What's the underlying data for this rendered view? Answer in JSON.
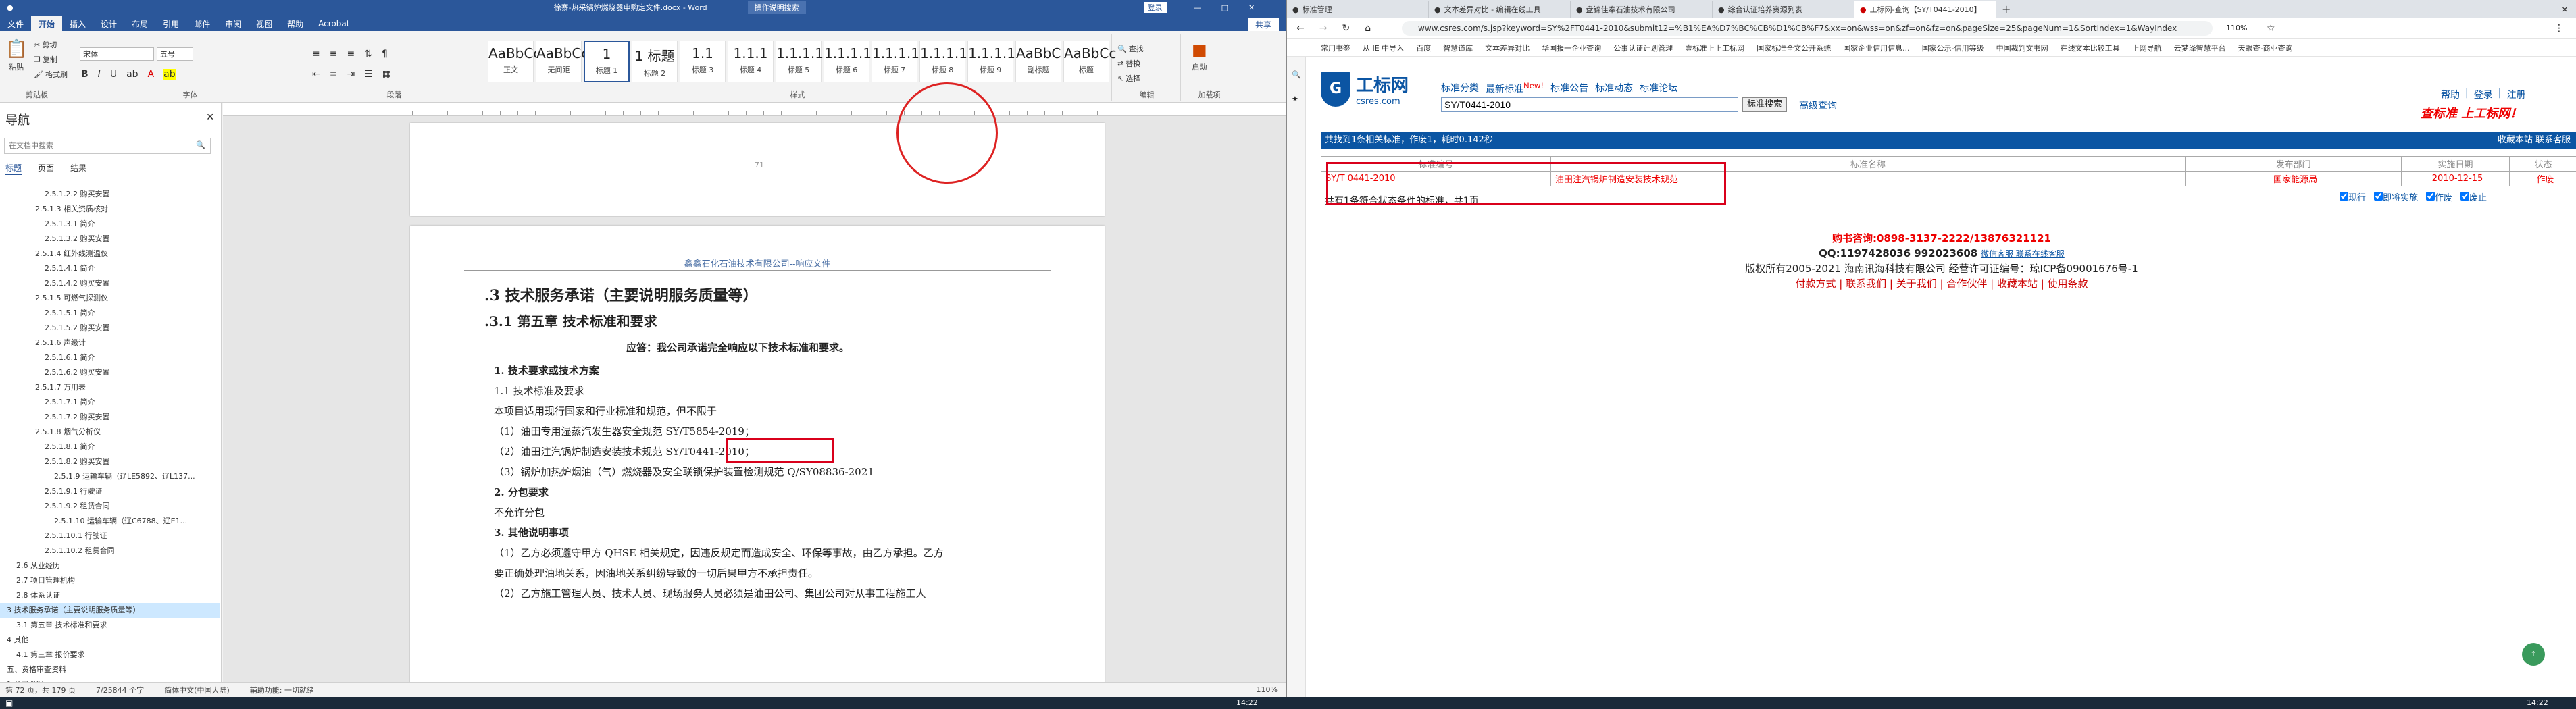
{
  "word": {
    "title_tab": "文件",
    "app_title": "徐寨-热采锅炉燃烧器申购定文件.docx - Word",
    "search_hint": "操作说明搜索",
    "login": "登录",
    "share": "共享",
    "ribbon_tabs": [
      "文件",
      "开始",
      "插入",
      "设计",
      "布局",
      "引用",
      "邮件",
      "审阅",
      "视图",
      "帮助",
      "Acrobat"
    ],
    "ribbon": {
      "paste": "粘贴",
      "cut": "剪切",
      "copy": "复制",
      "format_painter": "格式刷",
      "clipboard": "剪贴板",
      "font_name": "宋体",
      "font_size": "五号",
      "font_group": "字体",
      "para_group": "段落",
      "styles_group": "样式",
      "find": "查找",
      "replace": "替换",
      "select": "选择",
      "edit_group": "编辑",
      "launch": "启动",
      "launch_sub": "加载项",
      "styles": [
        {
          "preview": "AaBbCcDd",
          "name": "正文"
        },
        {
          "preview": "AaBbCcDd",
          "name": "无间距"
        },
        {
          "preview": "1",
          "name": "标题 1"
        },
        {
          "preview": "1 标题",
          "name": "标题 2"
        },
        {
          "preview": "1.1",
          "name": "标题 3"
        },
        {
          "preview": "1.1.1",
          "name": "标题 4"
        },
        {
          "preview": "1.1.1.1",
          "name": "标题 5"
        },
        {
          "preview": "1.1.1.1.1",
          "name": "标题 6"
        },
        {
          "preview": "1.1.1.1",
          "name": "标题 7"
        },
        {
          "preview": "1.1.1.1.1",
          "name": "标题 8"
        },
        {
          "preview": "1.1.1.1.1",
          "name": "标题 9"
        },
        {
          "preview": "AaBbC",
          "name": "副标题"
        },
        {
          "preview": "AaBbCc",
          "name": "标题"
        }
      ]
    },
    "nav": {
      "title": "导航",
      "search_placeholder": "在文档中搜索",
      "tabs": [
        "标题",
        "页面",
        "结果"
      ],
      "items": [
        "2.5.1.2.2 购买安置",
        "2.5.1.3 相关资质核对",
        "2.5.1.3.1 简介",
        "2.5.1.3.2 购买安置",
        "2.5.1.4 红外线测温仪",
        "2.5.1.4.1 简介",
        "2.5.1.4.2 购买安置",
        "2.5.1.5 可燃气探测仪",
        "2.5.1.5.1 简介",
        "2.5.1.5.2 购买安置",
        "2.5.1.6 声级计",
        "2.5.1.6.1 简介",
        "2.5.1.6.2 购买安置",
        "2.5.1.7 万用表",
        "2.5.1.7.1 简介",
        "2.5.1.7.2 购买安置",
        "2.5.1.8 烟气分析仪",
        "2.5.1.8.1 简介",
        "2.5.1.8.2 购买安置",
        "2.5.1.9 运输车辆（辽LE5892、辽L137...",
        "2.5.1.9.1 行驶证",
        "2.5.1.9.2 租赁合同",
        "2.5.1.10 运输车辆（辽C6788、辽E1...",
        "2.5.1.10.1 行驶证",
        "2.5.1.10.2 租赁合同",
        "2.6 从业经历",
        "2.7 项目管理机构",
        "2.8 体系认证",
        "3 技术服务承诺（主要说明服务质量等）",
        "3.1 第五章 技术标准和要求",
        "4 其他",
        "4.1 第三章 报价要求",
        "五、资格审查资料",
        "1 公司概况"
      ]
    },
    "doc": {
      "page1_footer": "71",
      "header_text": "鑫鑫石化石油技术有限公司--响应文件",
      "h1": ".3  技术服务承诺（主要说明服务质量等）",
      "h2": ".3.1   第五章 技术标准和要求",
      "reply": "应答：我公司承诺完全响应以下技术标准和要求。",
      "s1": "1. 技术要求或技术方案",
      "s11": "1.1 技术标准及要求",
      "p1": "本项目适用现行国家和行业标准和规范，但不限于",
      "l1": "（1）油田专用湿蒸汽发生器安全规范 SY/T5854-2019；",
      "l2": "（2）油田注汽锅炉制造安装技术规范 SY/T0441-2010；",
      "l3": "（3）锅炉加热炉烟油（气）燃烧器及安全联锁保护装置检测规范 Q/SY08836-2021",
      "s2": "2. 分包要求",
      "p2": "不允许分包",
      "s3": "3. 其他说明事项",
      "p3": "（1）乙方必须遵守甲方 QHSE 相关规定，因违反规定而造成安全、环保等事故，由乙方承担。乙方",
      "p4": "要正确处理油地关系，因油地关系纠纷导致的一切后果甲方不承担责任。",
      "p5": "（2）乙方施工管理人员、技术人员、现场服务人员必须是油田公司、集团公司对从事工程施工人"
    },
    "status": {
      "page": "第 72 页，共 179 页",
      "words": "7/25844 个字",
      "lang": "简体中文(中国大陆)",
      "macro": "辅助功能: 一切就绪",
      "zoom": "110%"
    }
  },
  "browser": {
    "tabs": [
      "标准管理",
      "文本差异对比 - 编辑在线工具",
      "盘锦佳奉石油技术有限公司",
      "综合认证培养资源列表",
      "工标网-查询【SY/T0441-2010】"
    ],
    "url": "www.csres.com/s.jsp?keyword=SY%2FT0441-2010&submit12=%B1%EA%D7%BC%CB%D1%CB%F7&xx=on&wss=on&zf=on&fz=on&pageSize=25&pageNum=1&SortIndex=1&WayIndex",
    "zoom": "110%",
    "bookmarks": [
      "常用书签",
      "从 IE 中导入",
      "百度",
      "智慧道库",
      "文本差异对比",
      "华国报一企业查询",
      "公事认证计划管理",
      "壹标准上上工标网",
      "国家标准全文公开系统",
      "国家企业信用信息...",
      "国家公示-信用等级",
      "中国裁判文书网",
      "在线文本比较工具",
      "上网导航",
      "云梦泽智慧平台",
      "天眼查-商业查询"
    ],
    "site": {
      "logo_cn": "工标网",
      "logo_en": "csres.com",
      "nav_links": [
        "标准分类",
        "最新标准",
        "标准公告",
        "标准动态",
        "标准论坛"
      ],
      "new_badge": "New!",
      "top_right": [
        "帮助",
        "登录",
        "注册"
      ],
      "slogan": "查标准 上工标网！",
      "query": "SY/T0441-2010",
      "search_btn": "标准搜索",
      "adv_search": "高级查询",
      "result_bar": "共找到1条相关标准，作废1，耗时0.142秒",
      "result_right": "收藏本站 联系客服",
      "columns": [
        "标准编号",
        "标准名称",
        "发布部门",
        "实施日期",
        "状态"
      ],
      "rows": [
        {
          "code": "SY/T 0441-2010",
          "name": "油田注汽锅炉制造安装技术规范",
          "dept": "国家能源局",
          "date": "2010-12-15",
          "status": "作废"
        }
      ],
      "count_text": "共有1条符合状态条件的标准，共1页",
      "filters": [
        "现行",
        "即将实施",
        "作废",
        "废止"
      ],
      "contact1": "购书咨询:0898-3137-2222/13876321121",
      "contact2": "QQ:1197428036 992023608",
      "contact2_link": "微信客服 联系在线客服",
      "copyright": "版权所有2005-2021 海南讯海科技有限公司 经营许可证编号：琼ICP备09001676号-1",
      "footer_links": [
        "付款方式",
        "联系我们",
        "关于我们",
        "合作伙伴",
        "收藏本站",
        "使用条款"
      ]
    }
  },
  "taskbar": {
    "time": "14:22"
  },
  "colors": {
    "word_blue": "#2b579a",
    "annot_red": "#d9001b",
    "site_blue": "#0b55a3"
  }
}
